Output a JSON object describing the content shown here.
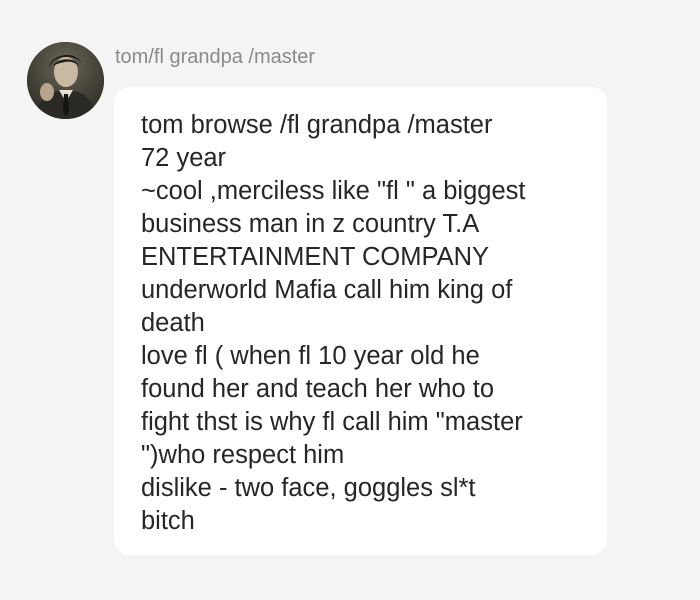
{
  "message": {
    "sender_name": "tom/fl grandpa /master",
    "avatar_icon": "profile-photo",
    "lines": [
      "tom browse /fl grandpa /master",
      "72 year",
      "~cool ,merciless like \"fl \" a biggest",
      "business man in z country T.A",
      "ENTERTAINMENT COMPANY",
      "underworld Mafia call him king of",
      "death",
      "love fl ( when fl 10 year old he",
      "found her and teach her who to",
      "fight thst is why fl call him \"master",
      "\")who respect him",
      "dislike - two face, goggles sl*t",
      "bitch"
    ]
  },
  "colors": {
    "background": "#f4f4f4",
    "bubble": "#ffffff",
    "name_text": "#8a8a8a",
    "message_text": "#262626"
  }
}
